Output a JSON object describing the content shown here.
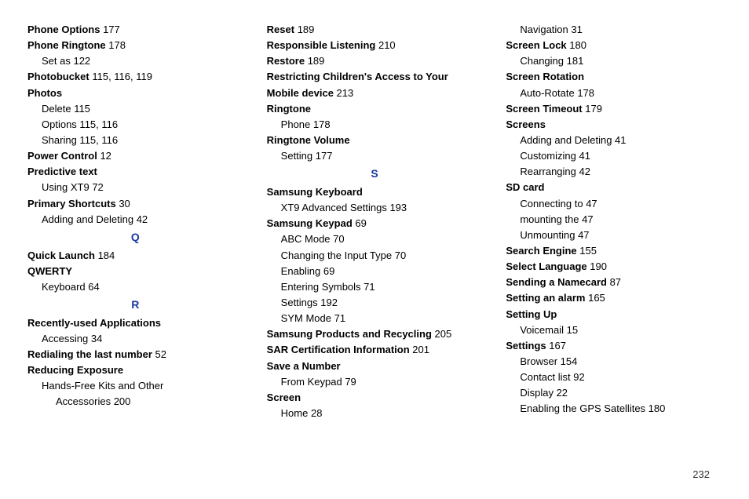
{
  "page_number": "232",
  "columns": [
    {
      "items": [
        {
          "type": "entry",
          "term": "Phone Options",
          "pages": " 177"
        },
        {
          "type": "entry",
          "term": "Phone Ringtone",
          "pages": " 178"
        },
        {
          "type": "sub",
          "label": "Set as",
          "pages": " 122"
        },
        {
          "type": "entry",
          "term": "Photobucket",
          "pages": " 115, 116, 119"
        },
        {
          "type": "entry",
          "term": "Photos",
          "pages": ""
        },
        {
          "type": "sub",
          "label": "Delete",
          "pages": " 115"
        },
        {
          "type": "sub",
          "label": "Options",
          "pages": " 115, 116"
        },
        {
          "type": "sub",
          "label": "Sharing",
          "pages": " 115, 116"
        },
        {
          "type": "entry",
          "term": "Power Control",
          "pages": " 12"
        },
        {
          "type": "entry",
          "term": "Predictive text",
          "pages": ""
        },
        {
          "type": "sub",
          "label": "Using XT9",
          "pages": " 72"
        },
        {
          "type": "entry",
          "term": "Primary Shortcuts",
          "pages": " 30"
        },
        {
          "type": "sub",
          "label": "Adding and Deleting",
          "pages": " 42"
        },
        {
          "type": "letter",
          "text": "Q"
        },
        {
          "type": "entry",
          "term": "Quick Launch",
          "pages": " 184"
        },
        {
          "type": "entry",
          "term": "QWERTY",
          "pages": ""
        },
        {
          "type": "sub",
          "label": "Keyboard",
          "pages": " 64"
        },
        {
          "type": "letter",
          "text": "R"
        },
        {
          "type": "entry",
          "term": "Recently-used Applications",
          "pages": ""
        },
        {
          "type": "sub",
          "label": "Accessing",
          "pages": " 34"
        },
        {
          "type": "entry",
          "term": "Redialing the last number",
          "pages": " 52"
        },
        {
          "type": "entry",
          "term": "Reducing Exposure",
          "pages": ""
        },
        {
          "type": "sub",
          "label": "Hands-Free Kits and Other",
          "pages": ""
        },
        {
          "type": "sub2",
          "label": "Accessories",
          "pages": " 200"
        }
      ]
    },
    {
      "items": [
        {
          "type": "entry",
          "term": "Reset",
          "pages": " 189"
        },
        {
          "type": "entry",
          "term": "Responsible Listening",
          "pages": " 210"
        },
        {
          "type": "entry",
          "term": "Restore",
          "pages": " 189"
        },
        {
          "type": "entry",
          "term": "Restricting Children's Access to Your Mobile device",
          "pages": " 213"
        },
        {
          "type": "entry",
          "term": "Ringtone",
          "pages": ""
        },
        {
          "type": "sub",
          "label": "Phone",
          "pages": " 178"
        },
        {
          "type": "entry",
          "term": "Ringtone Volume",
          "pages": ""
        },
        {
          "type": "sub",
          "label": "Setting",
          "pages": " 177"
        },
        {
          "type": "letter",
          "text": "S"
        },
        {
          "type": "entry",
          "term": "Samsung Keyboard",
          "pages": ""
        },
        {
          "type": "sub",
          "label": "XT9 Advanced Settings",
          "pages": " 193"
        },
        {
          "type": "entry",
          "term": "Samsung Keypad",
          "pages": " 69"
        },
        {
          "type": "sub",
          "label": "ABC Mode",
          "pages": " 70"
        },
        {
          "type": "sub",
          "label": "Changing the Input Type",
          "pages": " 70"
        },
        {
          "type": "sub",
          "label": "Enabling",
          "pages": " 69"
        },
        {
          "type": "sub",
          "label": "Entering Symbols",
          "pages": " 71"
        },
        {
          "type": "sub",
          "label": "Settings",
          "pages": " 192"
        },
        {
          "type": "sub",
          "label": "SYM Mode",
          "pages": " 71"
        },
        {
          "type": "entry",
          "term": "Samsung Products and Recycling",
          "pages": " 205"
        },
        {
          "type": "entry",
          "term": "SAR Certification Information",
          "pages": " 201"
        },
        {
          "type": "entry",
          "term": "Save a Number",
          "pages": ""
        },
        {
          "type": "sub",
          "label": "From Keypad",
          "pages": " 79"
        },
        {
          "type": "entry",
          "term": "Screen",
          "pages": ""
        },
        {
          "type": "sub",
          "label": "Home",
          "pages": " 28"
        }
      ]
    },
    {
      "items": [
        {
          "type": "sub",
          "label": "Navigation",
          "pages": " 31"
        },
        {
          "type": "entry",
          "term": "Screen Lock",
          "pages": " 180"
        },
        {
          "type": "sub",
          "label": "Changing",
          "pages": " 181"
        },
        {
          "type": "entry",
          "term": "Screen Rotation",
          "pages": ""
        },
        {
          "type": "sub",
          "label": "Auto-Rotate",
          "pages": " 178"
        },
        {
          "type": "entry",
          "term": "Screen Timeout",
          "pages": " 179"
        },
        {
          "type": "entry",
          "term": "Screens",
          "pages": ""
        },
        {
          "type": "sub",
          "label": "Adding and Deleting",
          "pages": " 41"
        },
        {
          "type": "sub",
          "label": "Customizing",
          "pages": " 41"
        },
        {
          "type": "sub",
          "label": "Rearranging",
          "pages": " 42"
        },
        {
          "type": "entry",
          "term": "SD card",
          "pages": ""
        },
        {
          "type": "sub",
          "label": "Connecting to",
          "pages": " 47"
        },
        {
          "type": "sub",
          "label": "mounting the",
          "pages": " 47"
        },
        {
          "type": "sub",
          "label": "Unmounting",
          "pages": " 47"
        },
        {
          "type": "entry",
          "term": "Search Engine",
          "pages": " 155"
        },
        {
          "type": "entry",
          "term": "Select Language",
          "pages": " 190"
        },
        {
          "type": "entry",
          "term": "Sending a Namecard",
          "pages": " 87"
        },
        {
          "type": "entry",
          "term": "Setting an alarm",
          "pages": " 165"
        },
        {
          "type": "entry",
          "term": "Setting Up",
          "pages": ""
        },
        {
          "type": "sub",
          "label": "Voicemail",
          "pages": " 15"
        },
        {
          "type": "entry",
          "term": "Settings",
          "pages": " 167"
        },
        {
          "type": "sub",
          "label": "Browser",
          "pages": " 154"
        },
        {
          "type": "sub",
          "label": "Contact list",
          "pages": " 92"
        },
        {
          "type": "sub",
          "label": "Display",
          "pages": " 22"
        },
        {
          "type": "sub",
          "label": "Enabling the GPS Satellites",
          "pages": " 180"
        }
      ]
    }
  ]
}
